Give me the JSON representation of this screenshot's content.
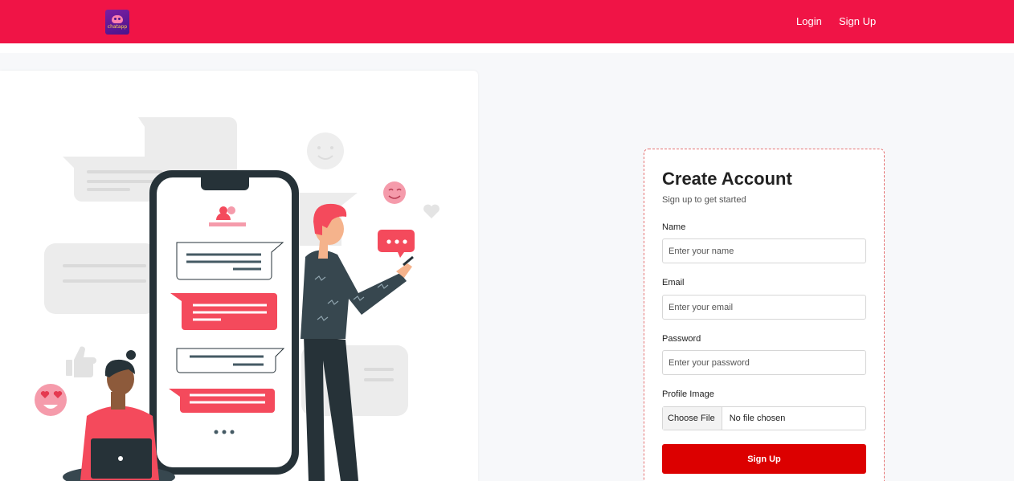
{
  "header": {
    "logo_text": "chatapp",
    "links": [
      {
        "label": "Login"
      },
      {
        "label": "Sign Up"
      }
    ],
    "brand_color": "#f01446"
  },
  "form": {
    "title": "Create Account",
    "subtitle": "Sign up to get started",
    "name_label": "Name",
    "name_placeholder": "Enter your name",
    "email_label": "Email",
    "email_placeholder": "Enter your email",
    "password_label": "Password",
    "password_placeholder": "Enter your password",
    "image_label": "Profile Image",
    "file_button": "Choose File",
    "file_status": "No file chosen",
    "submit_label": "Sign Up",
    "accent_color": "#dc0000"
  }
}
